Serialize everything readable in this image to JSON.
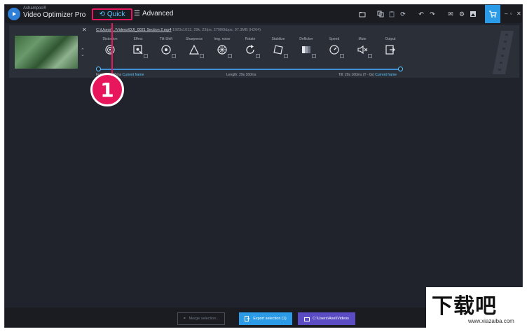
{
  "app": {
    "vendor": "Ashampoo®",
    "name": "Video Optimizer Pro"
  },
  "modes": {
    "quick": "Quick",
    "advanced": "Advanced"
  },
  "clip": {
    "path": "C:\\Users\\...\\Videos\\DJI_0021 Section 2.mp4",
    "info": "1920x1012, 29k, 23fps, 27980kbps, 97.3MB (H264)",
    "tools": [
      {
        "label": "Distortion",
        "icon": "lens-icon"
      },
      {
        "label": "Effect",
        "icon": "effect-icon"
      },
      {
        "label": "Tilt-Shift",
        "icon": "tilt-shift-icon"
      },
      {
        "label": "Sharpness",
        "icon": "sharpness-icon"
      },
      {
        "label": "Img. noise",
        "icon": "noise-icon"
      },
      {
        "label": "Rotate",
        "icon": "rotate-icon"
      },
      {
        "label": "Stabilize",
        "icon": "stabilize-icon"
      },
      {
        "label": "Deflicker",
        "icon": "deflicker-icon"
      },
      {
        "label": "Speed",
        "icon": "speed-icon"
      },
      {
        "label": "Mute",
        "icon": "mute-icon"
      },
      {
        "label": "Output",
        "icon": "output-icon"
      }
    ],
    "timeline": {
      "from_label": "From: 0s 000ms",
      "from_link": "Current frame",
      "length": "Length: 29s 160ms",
      "till_label": "Till: 29s 160ms (T - 0s)",
      "till_link": "Current frame"
    }
  },
  "annotation": {
    "number": "1"
  },
  "bottom": {
    "merge": "Merge selection...",
    "export": "Export selection (1)",
    "folder": "C:\\Users\\Axel\\Videos"
  },
  "watermark": {
    "big": "下载吧",
    "small": "www.xiazaiba.com"
  },
  "colors": {
    "accent": "#2b9be8",
    "highlight": "#e8175d",
    "folder_button": "#5b4cc4",
    "background": "#20232b"
  }
}
